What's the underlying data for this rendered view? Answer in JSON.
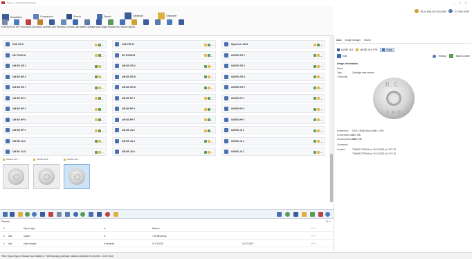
{
  "window": {
    "title": "Cases - Lumeris Forensic Suite",
    "controls": [
      "–",
      "□",
      "×"
    ]
  },
  "toolbar": {
    "acquisition": "Acquisition",
    "comparison": "Comparison",
    "search": "Search",
    "report": "Report",
    "database": "Database",
    "organizer": "Organizer",
    "ribbon_labels": "ELM BG ECM REF Reconnect Document Licenser user Firearms Contrast case Bullet Cartridge case Image Browse Info Videos Options"
  },
  "user": {
    "name": "ELM BALISCAN_MR",
    "secondary": "ECMA USR"
  },
  "grid": {
    "columns": [
      [
        {
          "label": "HAK FM 6",
          "ctrl": [
            "#e8b84a",
            "#5a9a5a"
          ]
        },
        {
          "label": "HK P2000-A",
          "ctrl": [
            "#e8b84a",
            "#5a9a5a"
          ]
        },
        {
          "label": "UM BS GR 1",
          "ctrl": [
            "#5a9a5a",
            "#e8b84a"
          ]
        },
        {
          "label": "UM BS HR 4",
          "ctrl": [
            "#5a9a5a",
            "#e8b84a"
          ]
        },
        {
          "label": "UM BS GR 7",
          "ctrl": [
            "#5a9a5a",
            "#e8b84a"
          ]
        },
        {
          "label": "UM BS HP 0",
          "ctrl": [
            "#e8b84a",
            "#5a9a5a"
          ]
        },
        {
          "label": "UM BS HP 3",
          "ctrl": [
            "#e8b84a",
            "#5a9a5a"
          ]
        },
        {
          "label": "UM BS HP 6",
          "ctrl": [
            "#e8b84a",
            "#5a9a5a"
          ]
        },
        {
          "label": "UM BS HP 9",
          "ctrl": [
            "#e8b84a",
            "#5a9a5a"
          ]
        },
        {
          "label": "UM BS JA 2",
          "ctrl": [
            "#5a9a5a",
            "#e8b84a"
          ]
        },
        {
          "label": "UM BS JA 5",
          "ctrl": [
            "#5a9a5a",
            "#e8b84a"
          ]
        }
      ],
      [
        {
          "label": "HAK FM 34",
          "ctrl": [
            "#e8b84a",
            "#5a9a5a"
          ]
        },
        {
          "label": "HK P2000-B",
          "ctrl": [
            "#e8b84a",
            "#5a9a5a"
          ]
        },
        {
          "label": "UM BS GR 2",
          "ctrl": [
            "#5a9a5a",
            "#e8b84a"
          ]
        },
        {
          "label": "UM BS GR 5",
          "ctrl": [
            "#5a9a5a",
            "#e8b84a"
          ]
        },
        {
          "label": "UM BS GR 8",
          "ctrl": [
            "#5a9a5a",
            "#e8b84a"
          ]
        },
        {
          "label": "UM BS HP 1",
          "ctrl": [
            "#e8b84a",
            "#5a9a5a"
          ]
        },
        {
          "label": "UM BS HP 4",
          "ctrl": [
            "#e8b84a",
            "#5a9a5a"
          ]
        },
        {
          "label": "UM BS HP 7",
          "ctrl": [
            "#e8b84a",
            "#5a9a5a"
          ]
        },
        {
          "label": "UM BS JA 0",
          "ctrl": [
            "#e8b84a",
            "#5a9a5a"
          ]
        },
        {
          "label": "UM BS JA 3",
          "ctrl": [
            "#5a9a5a",
            "#e8b84a"
          ]
        },
        {
          "label": "UM BS JA 6",
          "ctrl": [
            "#5a9a5a",
            "#e8b84a"
          ]
        }
      ],
      [
        {
          "label": "Hipzensel 2014",
          "ctrl": [
            "#e8b84a",
            "#5a9a5a"
          ]
        },
        {
          "label": "UM BS GR 0",
          "ctrl": [
            "#5a9a5a",
            "#e8b84a"
          ]
        },
        {
          "label": "UM BS GR 3",
          "ctrl": [
            "#5a9a5a",
            "#e8b84a"
          ]
        },
        {
          "label": "UM BS GR 6",
          "ctrl": [
            "#5a9a5a",
            "#e8b84a"
          ]
        },
        {
          "label": "UM BS GR 9",
          "ctrl": [
            "#5a9a5a",
            "#e8b84a"
          ]
        },
        {
          "label": "UM BS HP 2",
          "ctrl": [
            "#5a9a5a",
            "#e8b84a"
          ]
        },
        {
          "label": "UM BS HP 5",
          "ctrl": [
            "#5a9a5a",
            "#e8b84a"
          ]
        },
        {
          "label": "UM BS HP 8",
          "ctrl": [
            "#5a9a5a",
            "#e8b84a"
          ]
        },
        {
          "label": "UM BS JA 1",
          "ctrl": [
            "#5a9a5a",
            "#e8b84a"
          ]
        },
        {
          "label": "UM BS JA 4",
          "ctrl": [
            "#5a9a5a",
            "#e8b84a"
          ]
        },
        {
          "label": "UM BS JA 7",
          "ctrl": [
            "#5a9a5a",
            "#e8b84a"
          ]
        }
      ]
    ]
  },
  "thumbnails": [
    {
      "label": "UM BS JA 5 ..."
    },
    {
      "label": "UM BS JA 5 ..."
    },
    {
      "label": "UM BS JA 5 ..."
    }
  ],
  "filters": {
    "header": "Presets",
    "rows": [
      {
        "logic": "",
        "field": "Ejector type",
        "op": "is",
        "value": "Mauser",
        "value2": ""
      },
      {
        "logic": "and",
        "field": "Caliber",
        "op": "is",
        "value": "7.65 Browning",
        "value2": ""
      },
      {
        "logic": "and",
        "field": "Date created",
        "op": "is between",
        "value": "01.03.2024",
        "value2": "24.07.2024"
      }
    ],
    "summary": "Filter: Ejector type is 'Mauser' and Caliber is '7.65 Browning' and Date created is between 01.03.2024 - 24.07.2024"
  },
  "right_panel": {
    "tabs": [
      "Case",
      "Image manager",
      "Search"
    ],
    "subtabs": [
      "UM BS JA 5",
      "UM BS JA 5 1 PR",
      "Image"
    ],
    "edit_label": "Edit",
    "history_label": "History",
    "save_label": "Save & close",
    "section_title": "Image information",
    "fields": [
      {
        "k": "Name",
        "v": ""
      },
      {
        "k": "Type",
        "v": "Cartridge case bottom"
      },
      {
        "k": "Thumbnail",
        "v": ""
      }
    ],
    "coin_text_top": "R.C.",
    "coin_text_bottom": "S M H",
    "info": [
      {
        "k": "Dimensions",
        "v": "5224 x 5056 (Mono, 8bit) = 32%"
      },
      {
        "k": "Compressed size",
        "v": "22.4 MB"
      },
      {
        "k": "Uncompressed size",
        "v": "50.27 MB"
      },
      {
        "k": "Comments",
        "v": ""
      },
      {
        "k": "Created",
        "v": "TOMAS.STRAKA on 24.10.2023 at 14:27:18"
      },
      {
        "k": "",
        "v": "TOMAS.STRAKA on 24.10.2023 at 14:27:18"
      }
    ]
  }
}
